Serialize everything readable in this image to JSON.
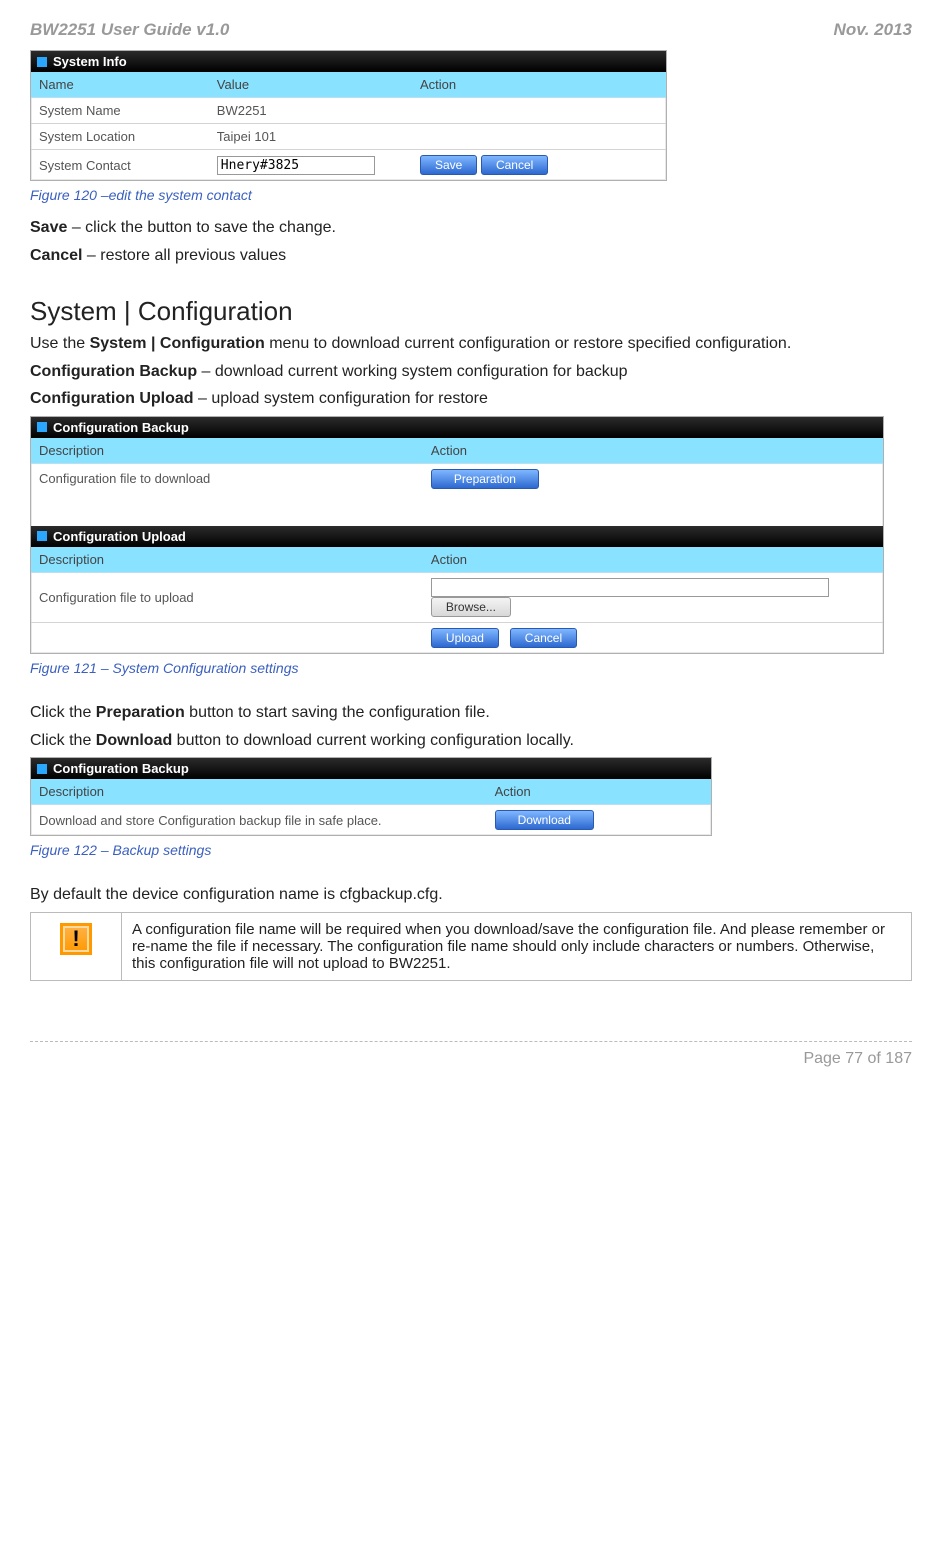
{
  "header": {
    "left": "BW2251 User Guide v1.0",
    "right": "Nov.  2013"
  },
  "sysinfo": {
    "panel_title": "System Info",
    "cols": [
      "Name",
      "Value",
      "Action"
    ],
    "rows": [
      {
        "name": "System Name",
        "value": "BW2251"
      },
      {
        "name": "System Location",
        "value": "Taipei 101"
      },
      {
        "name": "System Contact",
        "value_input": "Hnery#3825",
        "save": "Save",
        "cancel": "Cancel"
      }
    ]
  },
  "fig120": "Figure 120 –edit the system contact",
  "save_line": {
    "b": "Save",
    "rest": " – click the button to save the change."
  },
  "cancel_line": {
    "b": "Cancel",
    "rest": " – restore all previous values"
  },
  "section_title": "System | Configuration",
  "cfg_intro": {
    "pre": "Use the ",
    "b": "System | Configuration",
    "post": " menu to download current configuration or restore specified configuration."
  },
  "cfg_backup_line": {
    "b": "Configuration Backup",
    "rest": " – download current working system configuration for backup"
  },
  "cfg_upload_line": {
    "b": "Configuration Upload",
    "rest": " – upload system configuration for restore"
  },
  "cfg_backup_panel": {
    "title": "Configuration Backup",
    "cols": [
      "Description",
      "Action"
    ],
    "row_desc": "Configuration file to download",
    "prep_btn": "Preparation"
  },
  "cfg_upload_panel": {
    "title": "Configuration Upload",
    "cols": [
      "Description",
      "Action"
    ],
    "row_desc": "Configuration file to upload",
    "browse": "Browse...",
    "upload": "Upload",
    "cancel": "Cancel"
  },
  "fig121": "Figure 121 – System Configuration settings",
  "prep_line": {
    "pre": "Click the ",
    "b": "Preparation",
    "post": " button to start saving the configuration file."
  },
  "dl_line": {
    "pre": "Click the ",
    "b": "Download",
    "post": " button to download current working configuration locally."
  },
  "dl_panel": {
    "title": "Configuration Backup",
    "cols": [
      "Description",
      "Action"
    ],
    "row_desc": "Download and store Configuration backup file in safe place.",
    "dl_btn": "Download"
  },
  "fig122": "Figure 122 – Backup settings",
  "default_name": "By default the device configuration name is cfgbackup.cfg.",
  "note": "A configuration file name will be required when you download/save the configuration file. And please remember or re-name the file if necessary. The configuration file name should only include characters or numbers. Otherwise, this configuration file will not upload to BW2251.",
  "footer": "Page 77 of 187"
}
